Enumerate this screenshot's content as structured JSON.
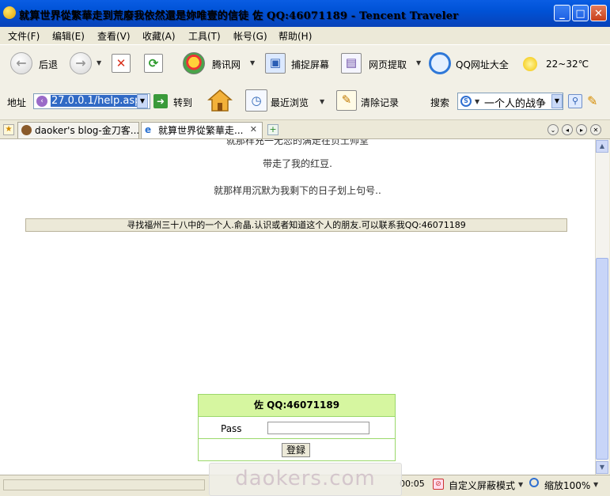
{
  "window": {
    "title": "就算世界從繁華走到荒廢我依然還是妳唯壹的信徒 佐 QQ:46071189 - Tencent Traveler",
    "minimize": "_",
    "maximize": "□",
    "close": "✕"
  },
  "menu": [
    "文件(F)",
    "编辑(E)",
    "查看(V)",
    "收藏(A)",
    "工具(T)",
    "帐号(G)",
    "帮助(H)"
  ],
  "toolbar": {
    "back_label": "后退",
    "tencent_label": "腾讯网",
    "screenshot_label": "捕捉屏幕",
    "extract_label": "网页提取",
    "qq_sites_label": "QQ网址大全",
    "weather_label": "22~32℃"
  },
  "toolbar2": {
    "address_label": "地址",
    "address_value": "27.0.0.1/help.asp",
    "go_label": "转到",
    "recent_label": "最近浏览",
    "clear_label": "清除记录",
    "search_label": "搜索",
    "search_value": "一个人的战争"
  },
  "tabs": [
    {
      "label": "daoker's blog-金刀客..."
    },
    {
      "label": "就算世界從繁華走..."
    }
  ],
  "content": {
    "line_partial": "就那样充一无恋的满走在负土帅堂",
    "line1": "带走了我的红豆.",
    "line2": "就那样用沉默为我剩下的日子划上句号..",
    "banner": "寻找福州三十八中的一个人.俞晶.认识或者知道这个人的朋友.可以联系我QQ:46071189"
  },
  "login": {
    "header": "佐  QQ:46071189",
    "pass_label": "Pass",
    "pass_value": "",
    "button_label": "登録"
  },
  "status": {
    "time": "00:05",
    "screen_mode": "自定义屏蔽模式",
    "zoom": "缩放100%"
  },
  "watermark": "daokers.com"
}
